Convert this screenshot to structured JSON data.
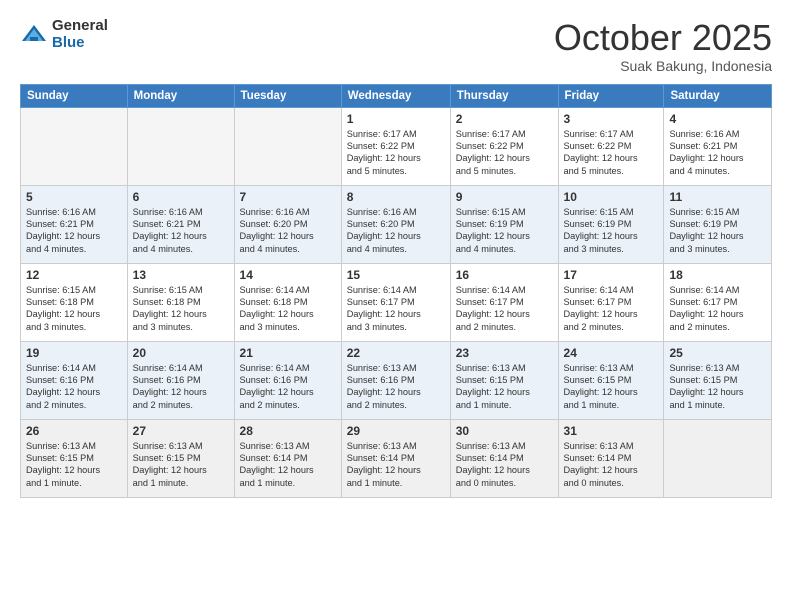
{
  "logo": {
    "general": "General",
    "blue": "Blue"
  },
  "title": "October 2025",
  "location": "Suak Bakung, Indonesia",
  "weekdays": [
    "Sunday",
    "Monday",
    "Tuesday",
    "Wednesday",
    "Thursday",
    "Friday",
    "Saturday"
  ],
  "weeks": [
    [
      {
        "day": "",
        "info": ""
      },
      {
        "day": "",
        "info": ""
      },
      {
        "day": "",
        "info": ""
      },
      {
        "day": "1",
        "info": "Sunrise: 6:17 AM\nSunset: 6:22 PM\nDaylight: 12 hours\nand 5 minutes."
      },
      {
        "day": "2",
        "info": "Sunrise: 6:17 AM\nSunset: 6:22 PM\nDaylight: 12 hours\nand 5 minutes."
      },
      {
        "day": "3",
        "info": "Sunrise: 6:17 AM\nSunset: 6:22 PM\nDaylight: 12 hours\nand 5 minutes."
      },
      {
        "day": "4",
        "info": "Sunrise: 6:16 AM\nSunset: 6:21 PM\nDaylight: 12 hours\nand 4 minutes."
      }
    ],
    [
      {
        "day": "5",
        "info": "Sunrise: 6:16 AM\nSunset: 6:21 PM\nDaylight: 12 hours\nand 4 minutes."
      },
      {
        "day": "6",
        "info": "Sunrise: 6:16 AM\nSunset: 6:21 PM\nDaylight: 12 hours\nand 4 minutes."
      },
      {
        "day": "7",
        "info": "Sunrise: 6:16 AM\nSunset: 6:20 PM\nDaylight: 12 hours\nand 4 minutes."
      },
      {
        "day": "8",
        "info": "Sunrise: 6:16 AM\nSunset: 6:20 PM\nDaylight: 12 hours\nand 4 minutes."
      },
      {
        "day": "9",
        "info": "Sunrise: 6:15 AM\nSunset: 6:19 PM\nDaylight: 12 hours\nand 4 minutes."
      },
      {
        "day": "10",
        "info": "Sunrise: 6:15 AM\nSunset: 6:19 PM\nDaylight: 12 hours\nand 3 minutes."
      },
      {
        "day": "11",
        "info": "Sunrise: 6:15 AM\nSunset: 6:19 PM\nDaylight: 12 hours\nand 3 minutes."
      }
    ],
    [
      {
        "day": "12",
        "info": "Sunrise: 6:15 AM\nSunset: 6:18 PM\nDaylight: 12 hours\nand 3 minutes."
      },
      {
        "day": "13",
        "info": "Sunrise: 6:15 AM\nSunset: 6:18 PM\nDaylight: 12 hours\nand 3 minutes."
      },
      {
        "day": "14",
        "info": "Sunrise: 6:14 AM\nSunset: 6:18 PM\nDaylight: 12 hours\nand 3 minutes."
      },
      {
        "day": "15",
        "info": "Sunrise: 6:14 AM\nSunset: 6:17 PM\nDaylight: 12 hours\nand 3 minutes."
      },
      {
        "day": "16",
        "info": "Sunrise: 6:14 AM\nSunset: 6:17 PM\nDaylight: 12 hours\nand 2 minutes."
      },
      {
        "day": "17",
        "info": "Sunrise: 6:14 AM\nSunset: 6:17 PM\nDaylight: 12 hours\nand 2 minutes."
      },
      {
        "day": "18",
        "info": "Sunrise: 6:14 AM\nSunset: 6:17 PM\nDaylight: 12 hours\nand 2 minutes."
      }
    ],
    [
      {
        "day": "19",
        "info": "Sunrise: 6:14 AM\nSunset: 6:16 PM\nDaylight: 12 hours\nand 2 minutes."
      },
      {
        "day": "20",
        "info": "Sunrise: 6:14 AM\nSunset: 6:16 PM\nDaylight: 12 hours\nand 2 minutes."
      },
      {
        "day": "21",
        "info": "Sunrise: 6:14 AM\nSunset: 6:16 PM\nDaylight: 12 hours\nand 2 minutes."
      },
      {
        "day": "22",
        "info": "Sunrise: 6:13 AM\nSunset: 6:16 PM\nDaylight: 12 hours\nand 2 minutes."
      },
      {
        "day": "23",
        "info": "Sunrise: 6:13 AM\nSunset: 6:15 PM\nDaylight: 12 hours\nand 1 minute."
      },
      {
        "day": "24",
        "info": "Sunrise: 6:13 AM\nSunset: 6:15 PM\nDaylight: 12 hours\nand 1 minute."
      },
      {
        "day": "25",
        "info": "Sunrise: 6:13 AM\nSunset: 6:15 PM\nDaylight: 12 hours\nand 1 minute."
      }
    ],
    [
      {
        "day": "26",
        "info": "Sunrise: 6:13 AM\nSunset: 6:15 PM\nDaylight: 12 hours\nand 1 minute."
      },
      {
        "day": "27",
        "info": "Sunrise: 6:13 AM\nSunset: 6:15 PM\nDaylight: 12 hours\nand 1 minute."
      },
      {
        "day": "28",
        "info": "Sunrise: 6:13 AM\nSunset: 6:14 PM\nDaylight: 12 hours\nand 1 minute."
      },
      {
        "day": "29",
        "info": "Sunrise: 6:13 AM\nSunset: 6:14 PM\nDaylight: 12 hours\nand 1 minute."
      },
      {
        "day": "30",
        "info": "Sunrise: 6:13 AM\nSunset: 6:14 PM\nDaylight: 12 hours\nand 0 minutes."
      },
      {
        "day": "31",
        "info": "Sunrise: 6:13 AM\nSunset: 6:14 PM\nDaylight: 12 hours\nand 0 minutes."
      },
      {
        "day": "",
        "info": ""
      }
    ]
  ]
}
